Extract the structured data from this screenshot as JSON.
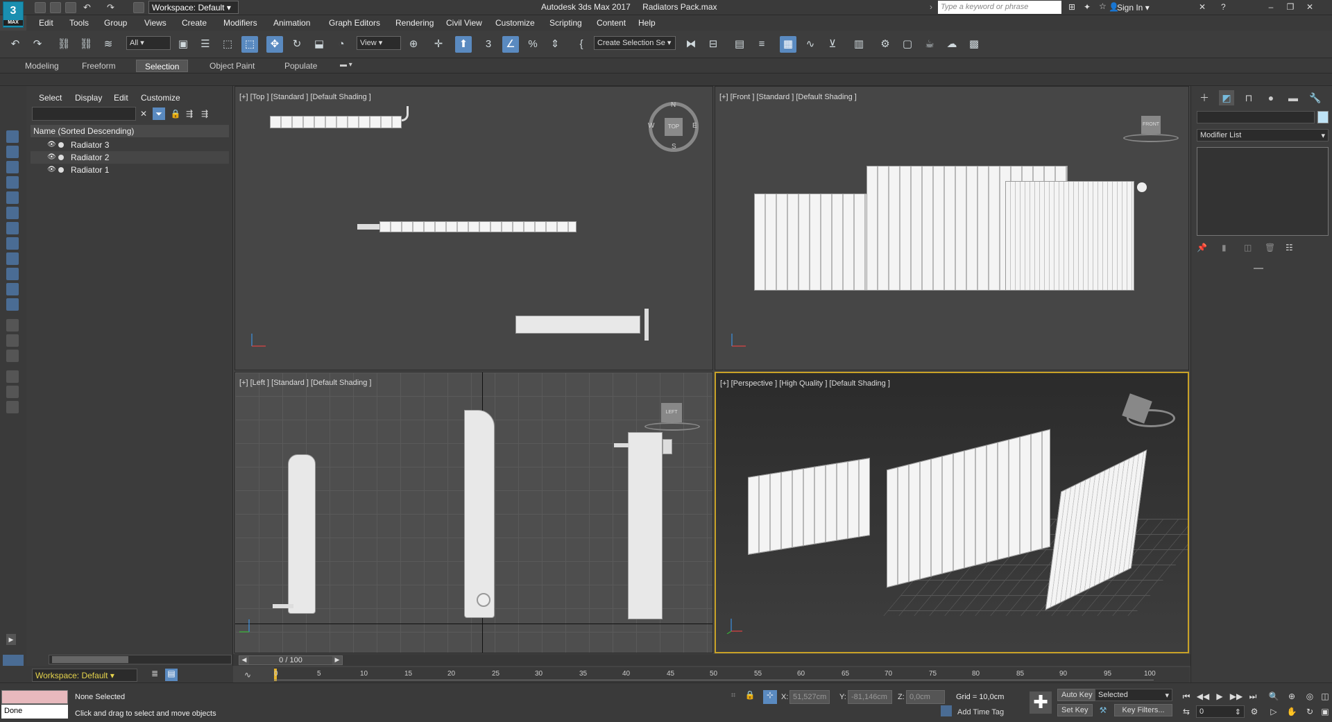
{
  "title_bar": {
    "app_title": "Autodesk 3ds Max 2017",
    "file_name": "Radiators Pack.max",
    "workspace_label": "Workspace: Default",
    "search_placeholder": "Type a keyword or phrase",
    "sign_in": "Sign In",
    "logo_text": "3",
    "logo_caption": "MAX"
  },
  "menus": [
    "Edit",
    "Tools",
    "Group",
    "Views",
    "Create",
    "Modifiers",
    "Animation",
    "Graph Editors",
    "Rendering",
    "Civil View",
    "Customize",
    "Scripting",
    "Content",
    "Help"
  ],
  "toolbar": {
    "filter_select": "All",
    "coord_select": "View",
    "selection_set_select": "Create Selection Se"
  },
  "ribbon_tabs": [
    "Modeling",
    "Freeform",
    "Selection",
    "Object Paint",
    "Populate"
  ],
  "ribbon_active_tab": "Selection",
  "scene_explorer": {
    "tabs": [
      "Select",
      "Display",
      "Edit",
      "Customize"
    ],
    "column_header": "Name (Sorted Descending)",
    "items": [
      "Radiator 3",
      "Radiator 2",
      "Radiator 1"
    ],
    "workspace_bottom": "Workspace: Default"
  },
  "viewports": {
    "top": "[+] [Top ] [Standard ] [Default Shading ]",
    "front": "[+] [Front ] [Standard ] [Default Shading ]",
    "left": "[+] [Left ] [Standard ] [Default Shading ]",
    "perspective": "[+] [Perspective ] [High Quality ] [Default Shading ]",
    "compass": {
      "n": "N",
      "s": "S",
      "w": "W",
      "e": "E",
      "cube": "TOP"
    },
    "front_cube": "FRONT",
    "left_cube": "LEFT"
  },
  "command_panel": {
    "modifier_list": "Modifier List"
  },
  "timeline": {
    "slider_label": "0 / 100",
    "ticks": [
      "0",
      "5",
      "10",
      "15",
      "20",
      "25",
      "30",
      "35",
      "40",
      "45",
      "50",
      "55",
      "60",
      "65",
      "70",
      "75",
      "80",
      "85",
      "90",
      "95",
      "100"
    ]
  },
  "status": {
    "done": "Done",
    "selection": "None Selected",
    "prompt": "Click and drag to select and move objects",
    "x_label": "X:",
    "x_value": "51,527cm",
    "y_label": "Y:",
    "y_value": "-81,146cm",
    "z_label": "Z:",
    "z_value": "0,0cm",
    "grid": "Grid = 10,0cm",
    "add_time_tag": "Add Time Tag",
    "auto_key": "Auto Key",
    "set_key": "Set Key",
    "key_mode": "Selected",
    "key_filters": "Key Filters...",
    "frame": "0"
  },
  "colors": {
    "accent": "#5a8ac0",
    "active_viewport": "#c9a227"
  }
}
